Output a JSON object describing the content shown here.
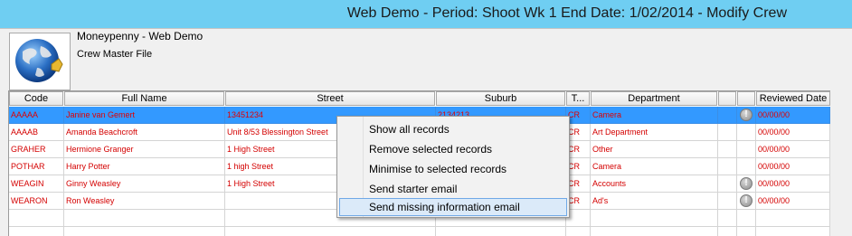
{
  "window": {
    "title": "Web Demo  - Period: Shoot Wk 1  End Date: 1/02/2014 - Modify Crew"
  },
  "header": {
    "company": "Moneypenny - Web Demo",
    "subtitle": "Crew Master File",
    "logo": "globe-logo"
  },
  "grid": {
    "columns": [
      {
        "key": "code",
        "label": "Code"
      },
      {
        "key": "name",
        "label": "Full Name"
      },
      {
        "key": "street",
        "label": "Street"
      },
      {
        "key": "suburb",
        "label": "Suburb"
      },
      {
        "key": "t",
        "label": "T..."
      },
      {
        "key": "department",
        "label": "Department"
      },
      {
        "key": "flag1",
        "label": ""
      },
      {
        "key": "flag2",
        "label": ""
      },
      {
        "key": "reviewed",
        "label": "Reviewed Date"
      }
    ],
    "rows": [
      {
        "code": "AAAAA",
        "name": "Janine van Gemert",
        "street": "13451234",
        "suburb": "2134213",
        "t": "CR",
        "department": "Camera",
        "warn": true,
        "reviewed": "00/00/00",
        "selected": true
      },
      {
        "code": "AAAAB",
        "name": "Amanda Beachcroft",
        "street": "Unit 8/53 Blessington Street",
        "suburb": "",
        "t": "CR",
        "department": "Art Department",
        "warn": false,
        "reviewed": "00/00/00",
        "selected": false
      },
      {
        "code": "GRAHER",
        "name": "Hermione Granger",
        "street": "1 High Street",
        "suburb": "",
        "t": "CR",
        "department": "Other",
        "warn": false,
        "reviewed": "00/00/00",
        "selected": false
      },
      {
        "code": "POTHAR",
        "name": "Harry Potter",
        "street": "1 high Street",
        "suburb": "",
        "t": "CR",
        "department": "Camera",
        "warn": false,
        "reviewed": "00/00/00",
        "selected": false
      },
      {
        "code": "WEAGIN",
        "name": "Ginny Weasley",
        "street": "1 High Street",
        "suburb": "",
        "t": "CR",
        "department": "Accounts",
        "warn": true,
        "reviewed": "00/00/00",
        "selected": false
      },
      {
        "code": "WEARON",
        "name": "Ron Weasley",
        "street": "",
        "suburb": "",
        "t": "CR",
        "department": "Ad's",
        "warn": true,
        "reviewed": "00/00/00",
        "selected": false
      },
      {
        "code": "",
        "name": "",
        "street": "",
        "suburb": "",
        "t": "",
        "department": "",
        "warn": false,
        "reviewed": "",
        "selected": false
      },
      {
        "code": "",
        "name": "",
        "street": "",
        "suburb": "",
        "t": "",
        "department": "",
        "warn": false,
        "reviewed": "",
        "selected": false
      }
    ],
    "warn_icon": "exclamation-circle-icon"
  },
  "context_menu": {
    "items": [
      {
        "label": "Show all records",
        "highlighted": false
      },
      {
        "label": "Remove selected records",
        "highlighted": false
      },
      {
        "label": "Minimise to selected records",
        "highlighted": false
      },
      {
        "label": "Send starter email",
        "highlighted": false
      },
      {
        "label": "Send missing information email",
        "highlighted": true
      }
    ]
  },
  "colors": {
    "titlebar": "#6fcef2",
    "selection": "#3399ff",
    "row_text": "#d40000"
  }
}
